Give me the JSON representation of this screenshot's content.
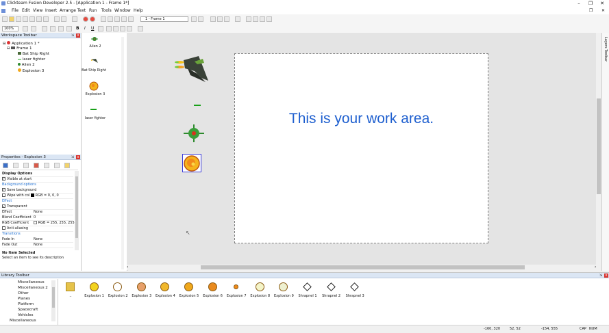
{
  "window": {
    "title": "Clickteam Fusion Developer 2.5 - [Application 1 - Frame 1*]"
  },
  "menu": [
    "File",
    "Edit",
    "View",
    "Insert",
    "Arrange",
    "Text",
    "Run",
    "Tools",
    "Window",
    "Help"
  ],
  "toolbar": {
    "frame_select": "1 - Frame 1",
    "zoom": "100%"
  },
  "workspace": {
    "title": "Workspace Toolbar",
    "items": [
      "Application 1 *",
      "Frame 1",
      "Bat Ship Right",
      "laser fighter",
      "Alien 2",
      "Explosion 3"
    ]
  },
  "objects": [
    "Alien 2",
    "Bat Ship Right",
    "Explosion 3",
    "laser fighter"
  ],
  "properties": {
    "title": "Properties - Explosion 3",
    "rows": [
      {
        "kind": "header",
        "label": "Display Options"
      },
      {
        "kind": "check",
        "label": "Visible at start",
        "checked": true
      },
      {
        "kind": "section",
        "label": "Background options"
      },
      {
        "kind": "check",
        "label": "Save background",
        "checked": true
      },
      {
        "kind": "check",
        "label": "Wipe with col",
        "checked": false,
        "value": "RGB = 0, 0, 0"
      },
      {
        "kind": "section",
        "label": "Effect"
      },
      {
        "kind": "check",
        "label": "Transparent",
        "checked": true
      },
      {
        "kind": "value",
        "label": "Effect",
        "value": "None"
      },
      {
        "kind": "value",
        "label": "Blend Coefficient",
        "value": "0"
      },
      {
        "kind": "value",
        "label": "RGB Coefficient",
        "value": "RGB = 255, 255, 255"
      },
      {
        "kind": "check",
        "label": "Anti-aliasing",
        "checked": false
      },
      {
        "kind": "section",
        "label": "Transitions"
      },
      {
        "kind": "value",
        "label": "Fade In",
        "value": "None"
      },
      {
        "kind": "value",
        "label": "Fade Out",
        "value": "None"
      }
    ],
    "desc_title": "No Item Selected",
    "desc_text": "Select an item to see its description"
  },
  "canvas": {
    "work_text": "This is your work area."
  },
  "layers": {
    "title": "Layers Toolbar"
  },
  "library": {
    "title": "Library Toolbar",
    "tree": [
      "Miscellaneous",
      "Miscellaneous 2",
      "Other",
      "Planes",
      "Platform",
      "Spacecraft",
      "Vehicles",
      "Miscellaneous"
    ],
    "items": [
      {
        "label": "..",
        "color": "#e6c34a"
      },
      {
        "label": "Explosion 1",
        "color": "#f3d31e"
      },
      {
        "label": "Explosion 2",
        "color": "#ffffff"
      },
      {
        "label": "Explosion 3",
        "color": "#e7a06a"
      },
      {
        "label": "Explosion 4",
        "color": "#f1b82c"
      },
      {
        "label": "Explosion 5",
        "color": "#f0a81c"
      },
      {
        "label": "Explosion 6",
        "color": "#e98a1e"
      },
      {
        "label": "Explosion 7",
        "color": "#f08a1a"
      },
      {
        "label": "Explosion 8",
        "color": "#f4f4c8"
      },
      {
        "label": "Explosion 9",
        "color": "#eef0d0"
      },
      {
        "label": "Shrapnel 1",
        "color": "#ffffff"
      },
      {
        "label": "Shrapnel 2",
        "color": "#ffffff"
      },
      {
        "label": "Shrapnel 3",
        "color": "#ffffff"
      }
    ]
  },
  "status": {
    "coords1": "-160, 320",
    "coords2": "52, 52",
    "coords3": "-154, 555",
    "caps": "CAP",
    "num": "NUM"
  },
  "colors": {
    "accent": "#1e5fcf",
    "panel_head": "#dbe6f4",
    "canvas_bg": "#e4e4e4"
  }
}
